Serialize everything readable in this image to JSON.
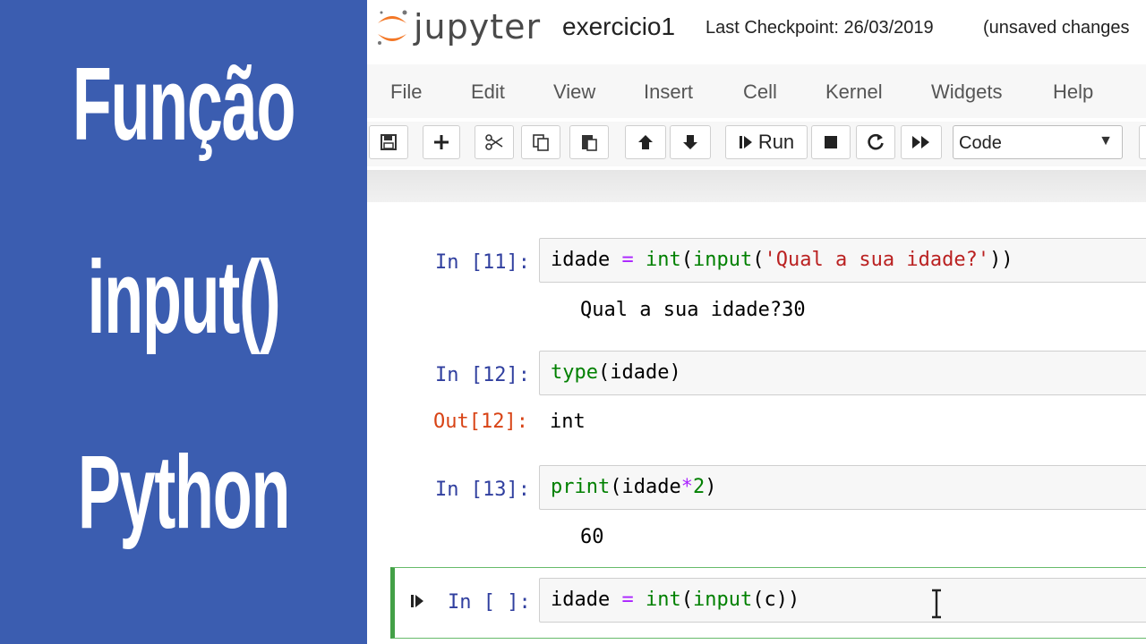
{
  "title_panel": {
    "words": [
      "Função",
      "input()",
      "Python"
    ]
  },
  "header": {
    "logo_text": "jupyter",
    "notebook_name": "exercicio1",
    "checkpoint": "Last Checkpoint: 26/03/2019",
    "unsaved": "(unsaved changes"
  },
  "menu": [
    "File",
    "Edit",
    "View",
    "Insert",
    "Cell",
    "Kernel",
    "Widgets",
    "Help"
  ],
  "toolbar": {
    "run_label": "Run",
    "cell_type": "Code",
    "icons": [
      "save-icon",
      "plus-icon",
      "scissors-icon",
      "copy-icon",
      "paste-icon",
      "arrow-up-icon",
      "arrow-down-icon",
      "run-icon",
      "stop-icon",
      "restart-icon",
      "fast-forward-icon",
      "dropdown-caret-icon"
    ]
  },
  "cells": [
    {
      "prompt": "In [11]:",
      "code": {
        "var": "idade",
        "op": "=",
        "fn1": "int",
        "fn2": "input",
        "str": "'Qual a sua idade?'",
        "close": "))"
      },
      "output": "Qual a sua idade?30"
    },
    {
      "prompt": "In [12]:",
      "code": {
        "fn": "type",
        "arg": "(idade)"
      },
      "out_prompt": "Out[12]:",
      "output": "int"
    },
    {
      "prompt": "In [13]:",
      "code": {
        "fn": "print",
        "open": "(idade",
        "op": "*",
        "num": "2",
        "close": ")"
      },
      "output": "60"
    },
    {
      "prompt": "In [ ]:",
      "code": {
        "var": "idade",
        "op": "=",
        "fn1": "int",
        "fn2": "input",
        "arg": "(c))"
      }
    }
  ],
  "colors": {
    "panel_blue": "#3b5db0",
    "prompt_in": "#303f9f",
    "prompt_out": "#d84315",
    "builtin_green": "#008000",
    "string_red": "#ba2121",
    "operator_purple": "#aa22ff",
    "selected_border": "#43a047"
  }
}
